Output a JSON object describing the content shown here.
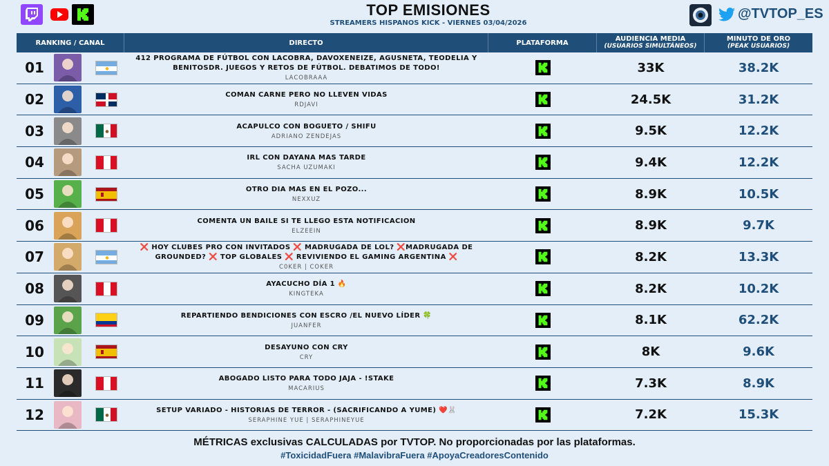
{
  "header": {
    "title": "TOP EMISIONES",
    "subtitle": "STREAMERS HISPANOS KICK - VIERNES 03/04/2026",
    "handle": "@TVTOP_ES"
  },
  "colors": {
    "accent": "#1f4e79",
    "kick": "#53fc18",
    "background": "#e3eef8"
  },
  "columns": {
    "rank": "RANKING / CANAL",
    "title": "DIRECTO",
    "platform": "PLATAFORMA",
    "audience": "AUDIENCIA MEDIA",
    "audience_sub": "(USUARIOS SIMULTÁNEOS)",
    "peak": "MINUTO DE ORO",
    "peak_sub": "(PEAK USUARIOS)"
  },
  "rows": [
    {
      "rank": "01",
      "flag": "AR",
      "avatar_color": "#7a5ca8",
      "title": "412 PROGRAMA DE FÚTBOL CON LACOBRA, DAVOXENEIZE, AGUSNETA, TEODELIA Y BENITOSDR. JUEGOS Y RETOS DE FÚTBOL. DEBATIMOS DE TODO!",
      "streamer": "LACOBRAAA",
      "audience": "33K",
      "peak": "38.2K",
      "platform": "kick-icon"
    },
    {
      "rank": "02",
      "flag": "DO",
      "avatar_color": "#2d5ea8",
      "title": "COMAN CARNE PERO NO LLEVEN VIDAS",
      "streamer": "RDJAVI",
      "audience": "24.5K",
      "peak": "31.2K",
      "platform": "kick-icon"
    },
    {
      "rank": "03",
      "flag": "MX",
      "avatar_color": "#8a8a8a",
      "title": "ACAPULCO CON BOGUETO / SHIFU",
      "streamer": "ADRIANO ZENDEJAS",
      "audience": "9.5K",
      "peak": "12.2K",
      "platform": "kick-icon"
    },
    {
      "rank": "04",
      "flag": "PE",
      "avatar_color": "#b59a7e",
      "title": "IRL CON DAYANA MAS TARDE",
      "streamer": "SACHA UZUMAKI",
      "audience": "9.4K",
      "peak": "12.2K",
      "platform": "kick-icon"
    },
    {
      "rank": "05",
      "flag": "ES",
      "avatar_color": "#58b04a",
      "title": "OTRO DIA MAS EN EL POZO...",
      "streamer": "NEXXUZ",
      "audience": "8.9K",
      "peak": "10.5K",
      "platform": "kick-icon"
    },
    {
      "rank": "06",
      "flag": "PE",
      "avatar_color": "#d9a45a",
      "title": "COMENTA UN BAILE SI TE LLEGO ESTA NOTIFICACION",
      "streamer": "ELZEEIN",
      "audience": "8.9K",
      "peak": "9.7K",
      "platform": "kick-icon"
    },
    {
      "rank": "07",
      "flag": "AR",
      "avatar_color": "#d4aa6a",
      "title": "❌ HOY CLUBES PRO CON INVITADOS ❌ MADRUGADA DE LOL? ❌MADRUGADA DE GROUNDED? ❌ TOP GLOBALES ❌ REVIVIENDO EL GAMING ARGENTINA ❌",
      "streamer": "C0KER | COKER",
      "audience": "8.2K",
      "peak": "13.3K",
      "platform": "kick-icon"
    },
    {
      "rank": "08",
      "flag": "PE",
      "avatar_color": "#555555",
      "title": "AYACUCHO DÍA 1 🔥",
      "streamer": "KINGTEKA",
      "audience": "8.2K",
      "peak": "10.2K",
      "platform": "kick-icon"
    },
    {
      "rank": "09",
      "flag": "CO",
      "avatar_color": "#5aa34a",
      "title": "REPARTIENDO BENDICIONES CON ESCRO /EL NUEVO LÍDER 🍀",
      "streamer": "JUANFER",
      "audience": "8.1K",
      "peak": "62.2K",
      "platform": "kick-icon"
    },
    {
      "rank": "10",
      "flag": "ES",
      "avatar_color": "#c8e2b8",
      "title": "DESAYUNO CON CRY",
      "streamer": "CRY",
      "audience": "8K",
      "peak": "9.6K",
      "platform": "kick-icon"
    },
    {
      "rank": "11",
      "flag": "PE",
      "avatar_color": "#2a2a2a",
      "title": "ABOGADO LISTO PARA TODO JAJA - !STAKE",
      "streamer": "MACARIUS",
      "audience": "7.3K",
      "peak": "8.9K",
      "platform": "kick-icon"
    },
    {
      "rank": "12",
      "flag": "MX",
      "avatar_color": "#e8b8c4",
      "title": "SETUP VARIADO - HISTORIAS DE TERROR - (SACRIFICANDO A YUME) ❤️🐰",
      "streamer": "SERAPHINE YUE | SERAPHINEYUE",
      "audience": "7.2K",
      "peak": "15.3K",
      "platform": "kick-icon"
    }
  ],
  "footer": {
    "line1": "MÉTRICAS exclusivas CALCULADAS por TVTOP. No proporcionadas por las plataformas.",
    "line2": "#ToxicidadFuera #MalavibraFuera #ApoyaCreadoresContenido"
  }
}
